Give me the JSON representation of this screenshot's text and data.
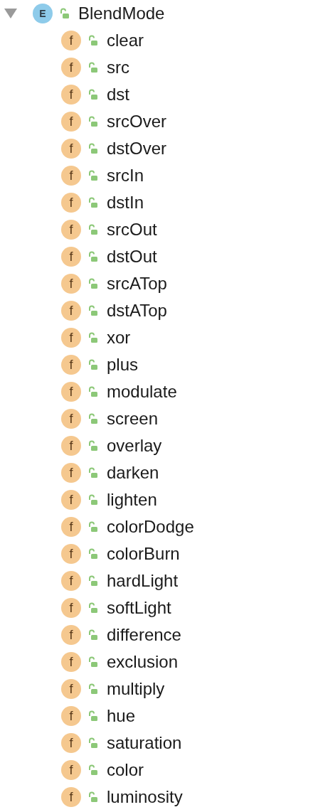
{
  "tree": {
    "label": "BlendMode",
    "kind": "enum",
    "badge": "E",
    "expanded": true,
    "children": [
      {
        "label": "clear",
        "kind": "field",
        "badge": "f"
      },
      {
        "label": "src",
        "kind": "field",
        "badge": "f"
      },
      {
        "label": "dst",
        "kind": "field",
        "badge": "f"
      },
      {
        "label": "srcOver",
        "kind": "field",
        "badge": "f"
      },
      {
        "label": "dstOver",
        "kind": "field",
        "badge": "f"
      },
      {
        "label": "srcIn",
        "kind": "field",
        "badge": "f"
      },
      {
        "label": "dstIn",
        "kind": "field",
        "badge": "f"
      },
      {
        "label": "srcOut",
        "kind": "field",
        "badge": "f"
      },
      {
        "label": "dstOut",
        "kind": "field",
        "badge": "f"
      },
      {
        "label": "srcATop",
        "kind": "field",
        "badge": "f"
      },
      {
        "label": "dstATop",
        "kind": "field",
        "badge": "f"
      },
      {
        "label": "xor",
        "kind": "field",
        "badge": "f"
      },
      {
        "label": "plus",
        "kind": "field",
        "badge": "f"
      },
      {
        "label": "modulate",
        "kind": "field",
        "badge": "f"
      },
      {
        "label": "screen",
        "kind": "field",
        "badge": "f"
      },
      {
        "label": "overlay",
        "kind": "field",
        "badge": "f"
      },
      {
        "label": "darken",
        "kind": "field",
        "badge": "f"
      },
      {
        "label": "lighten",
        "kind": "field",
        "badge": "f"
      },
      {
        "label": "colorDodge",
        "kind": "field",
        "badge": "f"
      },
      {
        "label": "colorBurn",
        "kind": "field",
        "badge": "f"
      },
      {
        "label": "hardLight",
        "kind": "field",
        "badge": "f"
      },
      {
        "label": "softLight",
        "kind": "field",
        "badge": "f"
      },
      {
        "label": "difference",
        "kind": "field",
        "badge": "f"
      },
      {
        "label": "exclusion",
        "kind": "field",
        "badge": "f"
      },
      {
        "label": "multiply",
        "kind": "field",
        "badge": "f"
      },
      {
        "label": "hue",
        "kind": "field",
        "badge": "f"
      },
      {
        "label": "saturation",
        "kind": "field",
        "badge": "f"
      },
      {
        "label": "color",
        "kind": "field",
        "badge": "f"
      },
      {
        "label": "luminosity",
        "kind": "field",
        "badge": "f"
      }
    ]
  }
}
